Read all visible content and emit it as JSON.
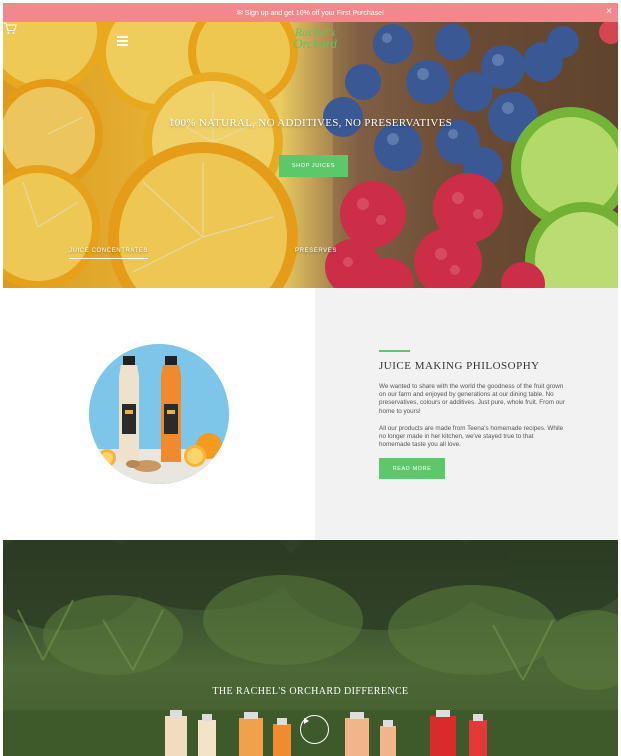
{
  "announcement": {
    "text": "✉ Sign up and get 10% off your First Purchase!",
    "close_symbol": "×"
  },
  "header": {
    "logo_line1": "Rachel's",
    "logo_line2": "Orchard",
    "icons": [
      "menu-icon",
      "cart-icon"
    ]
  },
  "hero": {
    "title": "100% NATURAL, NO ADDITIVES, NO PRESERVATIVES",
    "cta_label": "SHOP JUICES",
    "link_left": "JUICE CONCENTRATES",
    "link_right": "PRESERVES"
  },
  "philosophy": {
    "heading": "JUICE MAKING PHILOSOPHY",
    "paragraph1": "We wanted to share with the world the goodness of the fruit grown on our farm and enjoyed by generations at our dining table. No preservatives, colours or additives. Just pure, whole fruit. From our home to yours!",
    "paragraph2": "All our products are made from Teena's homemade recipes. While no longer made in her kitchen, we've stayed true to that homemade taste you all love.",
    "cta_label": "READ MORE"
  },
  "difference": {
    "title": "THE RACHEL'S ORCHARD DIFFERENCE",
    "icons": [
      "play-icon"
    ]
  },
  "colors": {
    "announcement_bg": "#f0888c",
    "accent_green": "#5cc86a",
    "panel_gray": "#f2f2f2"
  }
}
